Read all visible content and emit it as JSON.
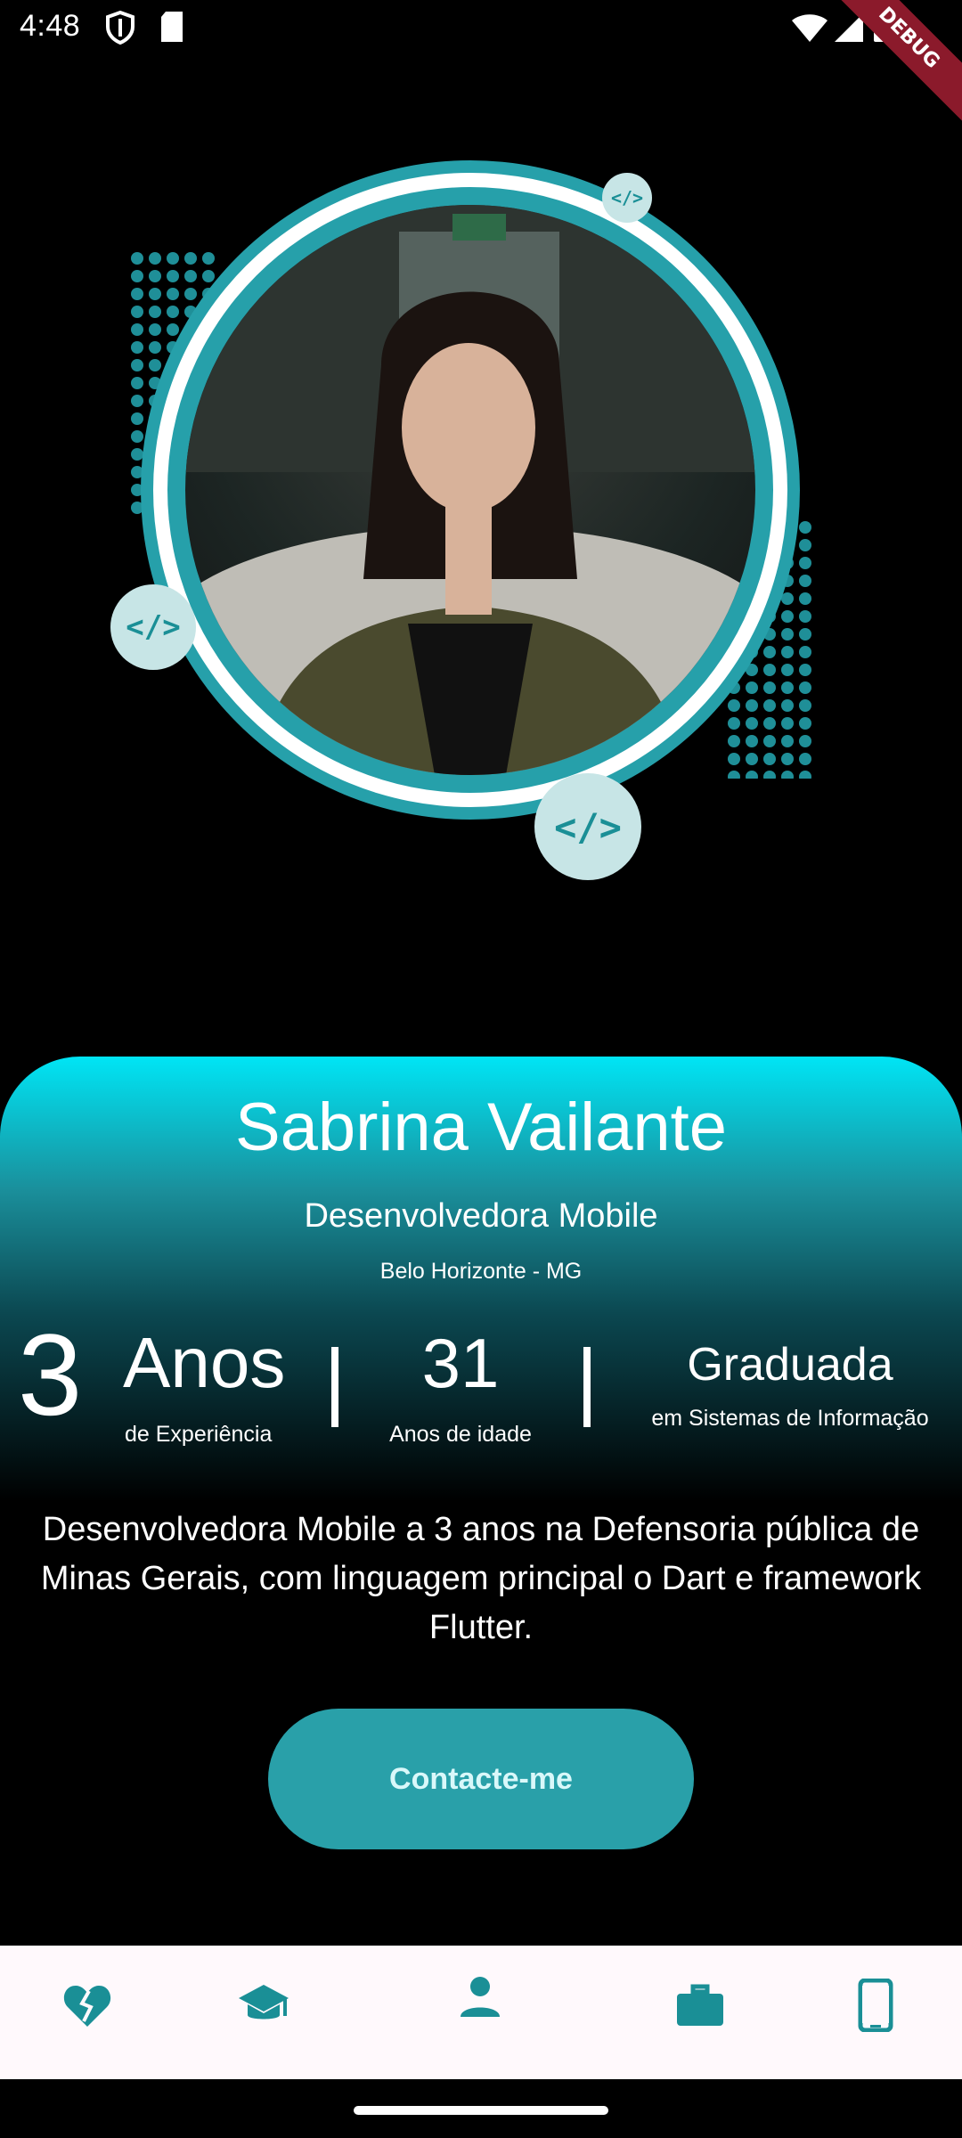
{
  "status_bar": {
    "time": "4:48",
    "debug_label": "DEBUG",
    "icons": [
      "shield-icon",
      "sd-card-icon",
      "wifi-icon",
      "signal-icon",
      "battery-icon"
    ]
  },
  "profile": {
    "badge_text": "</>",
    "photo_alt": "profile-photo",
    "colors": {
      "teal": "#26a0aa",
      "badge_bg": "#c7e5e6"
    }
  },
  "card": {
    "name": "Sabrina Vailante",
    "role": "Desenvolvedora Mobile",
    "city": "Belo Horizonte - MG",
    "stats": {
      "years_number": "3",
      "years_word": "Anos",
      "years_caption": "de Experiência",
      "age_number": "31",
      "age_caption": "Anos de idade",
      "degree": "Graduada",
      "degree_caption": "em Sistemas de Informação"
    },
    "gradient": [
      "#00e5f5",
      "#1a8f9b",
      "#0b4750",
      "#000000"
    ]
  },
  "bio": "Desenvolvedora Mobile a 3 anos na Defensoria pública de Minas Gerais, com linguagem principal o Dart e framework Flutter.",
  "contact_button": {
    "label": "Contacte-me",
    "color": "#29a0a9"
  },
  "bottom_nav": {
    "items": [
      {
        "icon": "broken-heart-icon"
      },
      {
        "icon": "graduation-cap-icon"
      },
      {
        "icon": "person-icon"
      },
      {
        "icon": "briefcase-icon"
      },
      {
        "icon": "smartphone-icon"
      }
    ],
    "active_index": 2,
    "accent": "#1a8f96"
  }
}
